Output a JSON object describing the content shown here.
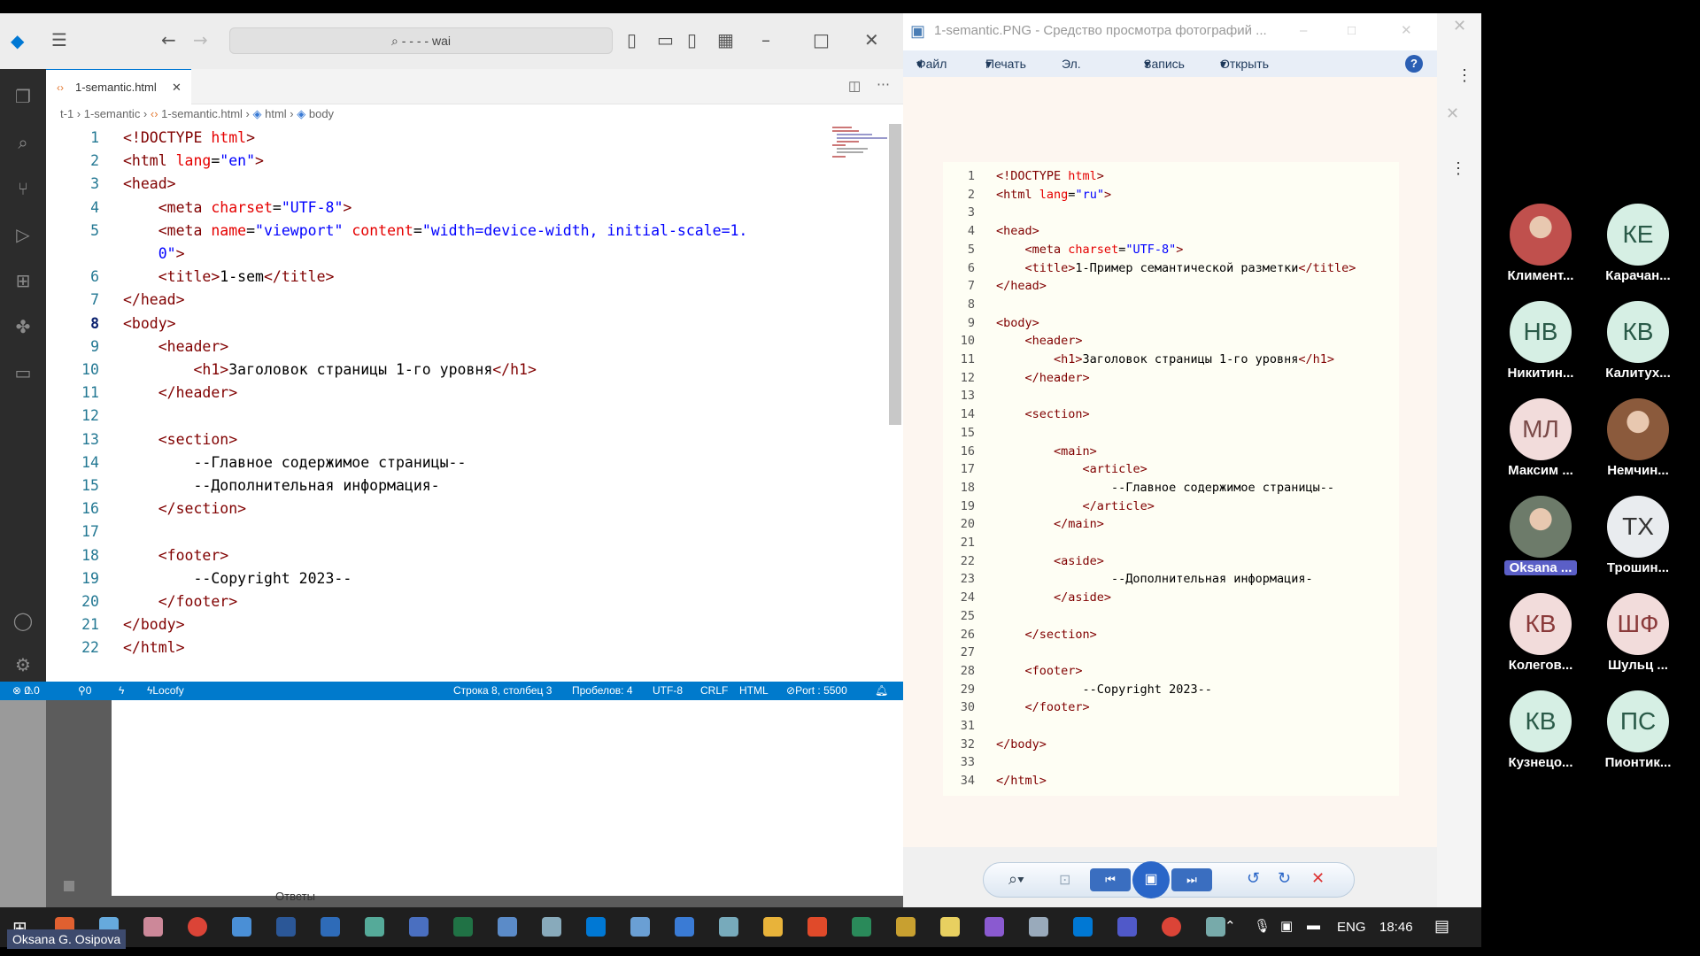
{
  "vscode": {
    "search": "- - - - wai",
    "tab_label": "1-semantic.html",
    "breadcrumb": [
      "t-1",
      "1-semantic",
      "1-semantic.html",
      "html",
      "body"
    ],
    "code": [
      {
        "n": "1",
        "parts": [
          [
            "t",
            "<!DOCTYPE "
          ],
          [
            "a",
            "html"
          ],
          [
            "t",
            ">"
          ]
        ]
      },
      {
        "n": "2",
        "parts": [
          [
            "t",
            "<html "
          ],
          [
            "a",
            "lang"
          ],
          [
            "x",
            "="
          ],
          [
            "v",
            "\"en\""
          ],
          [
            "t",
            ">"
          ]
        ]
      },
      {
        "n": "3",
        "parts": [
          [
            "t",
            "<head>"
          ]
        ]
      },
      {
        "n": "4",
        "parts": [
          [
            "x",
            "    "
          ],
          [
            "t",
            "<meta "
          ],
          [
            "a",
            "charset"
          ],
          [
            "x",
            "="
          ],
          [
            "v",
            "\"UTF-8\""
          ],
          [
            "t",
            ">"
          ]
        ]
      },
      {
        "n": "5",
        "parts": [
          [
            "x",
            "    "
          ],
          [
            "t",
            "<meta "
          ],
          [
            "a",
            "name"
          ],
          [
            "x",
            "="
          ],
          [
            "v",
            "\"viewport\""
          ],
          [
            "x",
            " "
          ],
          [
            "a",
            "content"
          ],
          [
            "x",
            "="
          ],
          [
            "v",
            "\"width=device-width, initial-scale=1."
          ]
        ]
      },
      {
        "n": "",
        "parts": [
          [
            "v",
            "    0\""
          ],
          [
            "t",
            ">"
          ]
        ]
      },
      {
        "n": "6",
        "parts": [
          [
            "x",
            "    "
          ],
          [
            "t",
            "<title>"
          ],
          [
            "x",
            "1-sem"
          ],
          [
            "t",
            "</title>"
          ]
        ]
      },
      {
        "n": "7",
        "parts": [
          [
            "t",
            "</head>"
          ]
        ]
      },
      {
        "n": "8",
        "parts": [
          [
            "t",
            "<body>"
          ]
        ]
      },
      {
        "n": "9",
        "parts": [
          [
            "x",
            "    "
          ],
          [
            "t",
            "<header>"
          ]
        ]
      },
      {
        "n": "10",
        "parts": [
          [
            "x",
            "        "
          ],
          [
            "t",
            "<h1>"
          ],
          [
            "x",
            "Заголовок страницы 1-го уровня"
          ],
          [
            "t",
            "</h1>"
          ]
        ]
      },
      {
        "n": "11",
        "parts": [
          [
            "x",
            "    "
          ],
          [
            "t",
            "</header>"
          ]
        ]
      },
      {
        "n": "12",
        "parts": []
      },
      {
        "n": "13",
        "parts": [
          [
            "x",
            "    "
          ],
          [
            "t",
            "<section>"
          ]
        ]
      },
      {
        "n": "14",
        "parts": [
          [
            "x",
            "        --Главное содержимое страницы--"
          ]
        ]
      },
      {
        "n": "15",
        "parts": [
          [
            "x",
            "        --Дополнительная информация-"
          ]
        ]
      },
      {
        "n": "16",
        "parts": [
          [
            "x",
            "    "
          ],
          [
            "t",
            "</section>"
          ]
        ]
      },
      {
        "n": "17",
        "parts": []
      },
      {
        "n": "18",
        "parts": [
          [
            "x",
            "    "
          ],
          [
            "t",
            "<footer>"
          ]
        ]
      },
      {
        "n": "19",
        "parts": [
          [
            "x",
            "        --Copyright 2023--"
          ]
        ]
      },
      {
        "n": "20",
        "parts": [
          [
            "x",
            "    "
          ],
          [
            "t",
            "</footer>"
          ]
        ]
      },
      {
        "n": "21",
        "parts": [
          [
            "t",
            "</body>"
          ]
        ]
      },
      {
        "n": "22",
        "parts": [
          [
            "t",
            "</html>"
          ]
        ]
      }
    ],
    "current_line": "8",
    "status": {
      "errors": "0",
      "warnings": "0",
      "ports": "0",
      "locofy": "Locofy",
      "position": "Строка 8, столбец 3",
      "spaces": "Пробелов: 4",
      "encoding": "UTF-8",
      "eol": "CRLF",
      "language": "HTML",
      "port": "Port : 5500"
    },
    "panel_label": "Ответы"
  },
  "viewer": {
    "title": "1-semantic.PNG - Средство просмотра фотографий ...",
    "menu": [
      "Файл",
      "Печать",
      "Эл. почта",
      "Запись",
      "Открыть"
    ],
    "code": [
      {
        "n": "1",
        "parts": [
          [
            "t",
            "<!DOCTYPE "
          ],
          [
            "a",
            "html"
          ],
          [
            "t",
            ">"
          ]
        ]
      },
      {
        "n": "2",
        "parts": [
          [
            "t",
            "<html "
          ],
          [
            "a",
            "lang"
          ],
          [
            "x",
            "="
          ],
          [
            "v",
            "\"ru\""
          ],
          [
            "t",
            ">"
          ]
        ]
      },
      {
        "n": "3",
        "parts": []
      },
      {
        "n": "4",
        "parts": [
          [
            "t",
            "<head>"
          ]
        ]
      },
      {
        "n": "5",
        "parts": [
          [
            "x",
            "    "
          ],
          [
            "t",
            "<meta "
          ],
          [
            "a",
            "charset"
          ],
          [
            "x",
            "="
          ],
          [
            "v",
            "\"UTF-8\""
          ],
          [
            "t",
            ">"
          ]
        ]
      },
      {
        "n": "6",
        "parts": [
          [
            "x",
            "    "
          ],
          [
            "t",
            "<title>"
          ],
          [
            "x",
            "1-Пример семантической разметки"
          ],
          [
            "t",
            "</title>"
          ]
        ]
      },
      {
        "n": "7",
        "parts": [
          [
            "t",
            "</head>"
          ]
        ]
      },
      {
        "n": "8",
        "parts": []
      },
      {
        "n": "9",
        "parts": [
          [
            "t",
            "<body>"
          ]
        ]
      },
      {
        "n": "10",
        "parts": [
          [
            "x",
            "    "
          ],
          [
            "t",
            "<header>"
          ]
        ]
      },
      {
        "n": "11",
        "parts": [
          [
            "x",
            "        "
          ],
          [
            "t",
            "<h1>"
          ],
          [
            "x",
            "Заголовок страницы 1-го уровня"
          ],
          [
            "t",
            "</h1>"
          ]
        ]
      },
      {
        "n": "12",
        "parts": [
          [
            "x",
            "    "
          ],
          [
            "t",
            "</header>"
          ]
        ]
      },
      {
        "n": "13",
        "parts": []
      },
      {
        "n": "14",
        "parts": [
          [
            "x",
            "    "
          ],
          [
            "t",
            "<section>"
          ]
        ]
      },
      {
        "n": "15",
        "parts": []
      },
      {
        "n": "16",
        "parts": [
          [
            "x",
            "        "
          ],
          [
            "t",
            "<main>"
          ]
        ]
      },
      {
        "n": "17",
        "parts": [
          [
            "x",
            "            "
          ],
          [
            "t",
            "<article>"
          ]
        ]
      },
      {
        "n": "18",
        "parts": [
          [
            "x",
            "                --Главное содержимое страницы--"
          ]
        ]
      },
      {
        "n": "19",
        "parts": [
          [
            "x",
            "            "
          ],
          [
            "t",
            "</article>"
          ]
        ]
      },
      {
        "n": "20",
        "parts": [
          [
            "x",
            "        "
          ],
          [
            "t",
            "</main>"
          ]
        ]
      },
      {
        "n": "21",
        "parts": []
      },
      {
        "n": "22",
        "parts": [
          [
            "x",
            "        "
          ],
          [
            "t",
            "<aside>"
          ]
        ]
      },
      {
        "n": "23",
        "parts": [
          [
            "x",
            "                --Дополнительная информация-"
          ]
        ]
      },
      {
        "n": "24",
        "parts": [
          [
            "x",
            "        "
          ],
          [
            "t",
            "</aside>"
          ]
        ]
      },
      {
        "n": "25",
        "parts": []
      },
      {
        "n": "26",
        "parts": [
          [
            "x",
            "    "
          ],
          [
            "t",
            "</section>"
          ]
        ]
      },
      {
        "n": "27",
        "parts": []
      },
      {
        "n": "28",
        "parts": [
          [
            "x",
            "    "
          ],
          [
            "t",
            "<footer>"
          ]
        ]
      },
      {
        "n": "29",
        "parts": [
          [
            "x",
            "            --Copyright 2023--"
          ]
        ]
      },
      {
        "n": "30",
        "parts": [
          [
            "x",
            "    "
          ],
          [
            "t",
            "</footer>"
          ]
        ]
      },
      {
        "n": "31",
        "parts": []
      },
      {
        "n": "32",
        "parts": [
          [
            "t",
            "</body>"
          ]
        ]
      },
      {
        "n": "33",
        "parts": []
      },
      {
        "n": "34",
        "parts": [
          [
            "t",
            "</html>"
          ]
        ]
      }
    ]
  },
  "participants": [
    {
      "initials": "",
      "name": "Климент...",
      "photo": true,
      "color": "#c0504d"
    },
    {
      "initials": "КЕ",
      "name": "Карачан...",
      "color": "#d6efe4"
    },
    {
      "initials": "НВ",
      "name": "Никитин...",
      "color": "#d6efe4"
    },
    {
      "initials": "КВ",
      "name": "Калитух...",
      "color": "#d6efe4"
    },
    {
      "initials": "МЛ",
      "name": "Максим ...",
      "color": "#f2dcdb",
      "fg": "#7a4a48"
    },
    {
      "initials": "",
      "name": "Немчин...",
      "photo": true,
      "color": "#8b5a3c"
    },
    {
      "initials": "",
      "name": "Oksana ...",
      "photo": true,
      "color": "#6d7b6a",
      "highlight": true
    },
    {
      "initials": "ТХ",
      "name": "Трошин...",
      "color": "#e9ecef",
      "fg": "#333"
    },
    {
      "initials": "КВ",
      "name": "Колегов...",
      "color": "#f2dcdb",
      "fg": "#8a3a3a"
    },
    {
      "initials": "ШФ",
      "name": "Шульц ...",
      "color": "#f2dcdb",
      "fg": "#8a3a3a"
    },
    {
      "initials": "КВ",
      "name": "Кузнецо...",
      "color": "#d6efe4"
    },
    {
      "initials": "ПС",
      "name": "Пионтик...",
      "color": "#d6efe4"
    }
  ],
  "taskbar": {
    "lang": "ENG",
    "time": "18:46",
    "user": "Oksana G. Osipova"
  }
}
